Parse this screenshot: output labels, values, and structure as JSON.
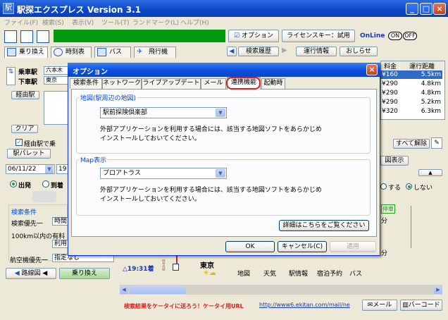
{
  "window": {
    "title": "駅探エクスプレス Version 3.1"
  },
  "menu": [
    "ファイル(F)",
    "検索(S)",
    "表示(V)",
    "ツール(T)",
    "ランドマーク(L)",
    "ヘルプ(H)"
  ],
  "toolbar": {
    "option_label": "オプション",
    "license_label": "ライセンスキー：試用",
    "online_label": "OnLine",
    "on_label": "ON",
    "off_label": "OFF"
  },
  "main_tabs": [
    "乗り換え",
    "時刻表",
    "バス",
    "飛行機"
  ],
  "history": {
    "search_history": "検索履歴",
    "operation_info": "運行情報",
    "notice": "おしらせ"
  },
  "left": {
    "board_label": "乗車駅",
    "board_value": "六本木",
    "alight_label": "下車駅",
    "alight_value": "東京",
    "via_label": "経由駅",
    "clear_label": "クリア",
    "via_check_label": "経由駅で乗",
    "palette_label": "駅パレット",
    "date_value": "06/11/22",
    "time_value": "19",
    "depart_label": "出発",
    "arrive_label": "到着",
    "conditions_title": "検索条件",
    "priority_label": "検索優先一",
    "priority_value": "時間",
    "distance_text": "100km以内の有料",
    "use_label": "利用",
    "air_label": "航空機優先一",
    "air_value": "指定なし",
    "route_map_label": "路線図",
    "transfer_label": "乗り換え"
  },
  "results": {
    "col_fare": "料金",
    "col_distance": "運行距離",
    "rows": [
      {
        "fare": "¥160",
        "distance": "5.5km"
      },
      {
        "fare": "¥290",
        "distance": "4.8km"
      },
      {
        "fare": "¥290",
        "distance": "4.8km"
      },
      {
        "fare": "¥290",
        "distance": "5.2km"
      },
      {
        "fare": "¥320",
        "distance": "6.3km"
      }
    ],
    "all_release_label": "すべて解除",
    "map_display_label": "図表示",
    "radio_yes": "する",
    "radio_no": "しない",
    "fun_label": "分",
    "stop_label": "停車"
  },
  "route": {
    "arrival_time": "△19:31着",
    "station": "東京",
    "links": [
      "地図",
      "天気",
      "駅情報",
      "宿泊予約",
      "バス"
    ]
  },
  "footer": {
    "promo": "検索結果をケータイに送ろう！ケータイ用URL",
    "url": "http://www6.ekitan.com/mail/ne",
    "mail_label": "メール",
    "barcode_label": "バーコード"
  },
  "dialog": {
    "title": "オプション",
    "tabs": [
      "検索条件",
      "ネットワーク",
      "ライブアップデート",
      "メール",
      "連携機能",
      "起動時"
    ],
    "active_tab": "連携機能",
    "group1_title": "地図(駅周辺の地図)",
    "group1_select": "駅前探険倶楽部",
    "group1_text1": "外部アプリケーションを利用する場合には、該当する地図ソフトをあらかじめ",
    "group1_text2": "インストールしておいてください。",
    "group2_title": "Map表示",
    "group2_select": "プロアトラス",
    "group2_text1": "外部アプリケーションを利用する場合には、該当する地図ソフトをあらかじめ",
    "group2_text2": "インストールしておいてください。",
    "details_button": "詳細はこちらをご覧ください",
    "ok_button": "OK",
    "cancel_button": "キャンセル(C)",
    "apply_button": "適用"
  }
}
